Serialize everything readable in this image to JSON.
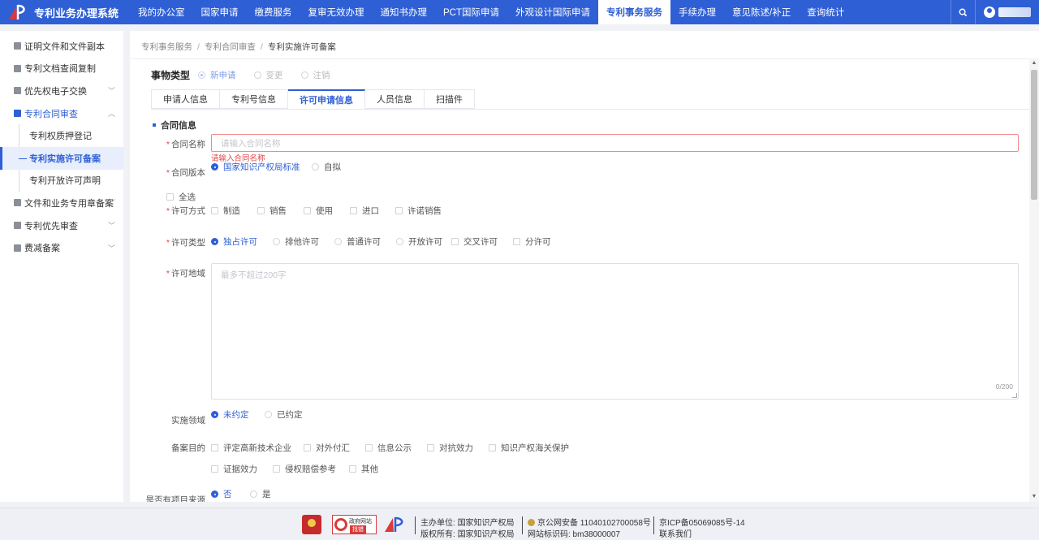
{
  "header": {
    "app_title": "专利业务办理系统",
    "nav": [
      "我的办公室",
      "国家申请",
      "缴费服务",
      "复审无效办理",
      "通知书办理",
      "PCT国际申请",
      "外观设计国际申请",
      "专利事务服务",
      "手续办理",
      "意见陈述/补正",
      "查询统计"
    ],
    "active_nav": "专利事务服务",
    "icons": {
      "search": "search-icon",
      "user": "user-avatar-icon"
    }
  },
  "sidebar": {
    "items": [
      {
        "label": "证明文件和文件副本"
      },
      {
        "label": "专利文档查阅复制"
      },
      {
        "label": "优先权电子交换",
        "arrow": "﹀"
      },
      {
        "label": "专利合同审查",
        "arrow": "︿"
      },
      {
        "label": "文件和业务专用章备案",
        "arrow": "﹀"
      },
      {
        "label": "专利优先审查",
        "arrow": "﹀"
      },
      {
        "label": "费减备案",
        "arrow": "﹀"
      }
    ],
    "sub_items": [
      {
        "label": "专利权质押登记"
      },
      {
        "label": "专利实施许可备案"
      },
      {
        "label": "专利开放许可声明"
      }
    ]
  },
  "breadcrumb": [
    "专利事务服务",
    "专利合同审查",
    "专利实施许可备案"
  ],
  "matter_type": {
    "label": "事物类型",
    "options": [
      "新申请",
      "变更",
      "注销"
    ]
  },
  "tabs": [
    "申请人信息",
    "专利号信息",
    "许可申请信息",
    "人员信息",
    "扫描件"
  ],
  "active_tab": "许可申请信息",
  "section": {
    "title": "合同信息"
  },
  "form": {
    "contract_name": {
      "label": "合同名称",
      "placeholder": "请输入合同名称",
      "error": "请输入合同名称"
    },
    "contract_version": {
      "label": "合同版本",
      "options": [
        "国家知识产权局标准",
        "自拟"
      ]
    },
    "select_all": "全选",
    "license_mode": {
      "label": "许可方式",
      "options": [
        "制造",
        "销售",
        "使用",
        "进口",
        "许诺销售"
      ]
    },
    "license_type": {
      "label": "许可类型",
      "options": [
        "独占许可",
        "排他许可",
        "普通许可",
        "开放许可",
        "交叉许可",
        "分许可"
      ]
    },
    "license_region": {
      "label": "许可地域",
      "placeholder": "最多不超过200字",
      "counter": "0/200"
    },
    "field": {
      "label": "实施领域",
      "options": [
        "未约定",
        "已约定"
      ]
    },
    "purpose": {
      "label": "备案目的",
      "options_row1": [
        "评定高新技术企业",
        "对外付汇",
        "信息公示",
        "对抗效力",
        "知识产权海关保护"
      ],
      "options_row2": [
        "证据效力",
        "侵权赔偿参考",
        "其他"
      ]
    },
    "project_source": {
      "label": "是否有项目来源",
      "options": [
        "否",
        "是"
      ]
    }
  },
  "footer": {
    "badge_line1": "政府网站",
    "badge_line2": "找错",
    "host_label": "主办单位:",
    "host_value": "国家知识产权局",
    "copyright_label": "版权所有:",
    "copyright_value": "国家知识产权局",
    "police": "京公网安备 11040102700058号",
    "site_code": "网站标识码: bm38000007",
    "icp": "京ICP备05069085号-14",
    "contact": "联系我们"
  },
  "colors": {
    "primary": "#2f5fd4",
    "error": "#e0454a"
  }
}
